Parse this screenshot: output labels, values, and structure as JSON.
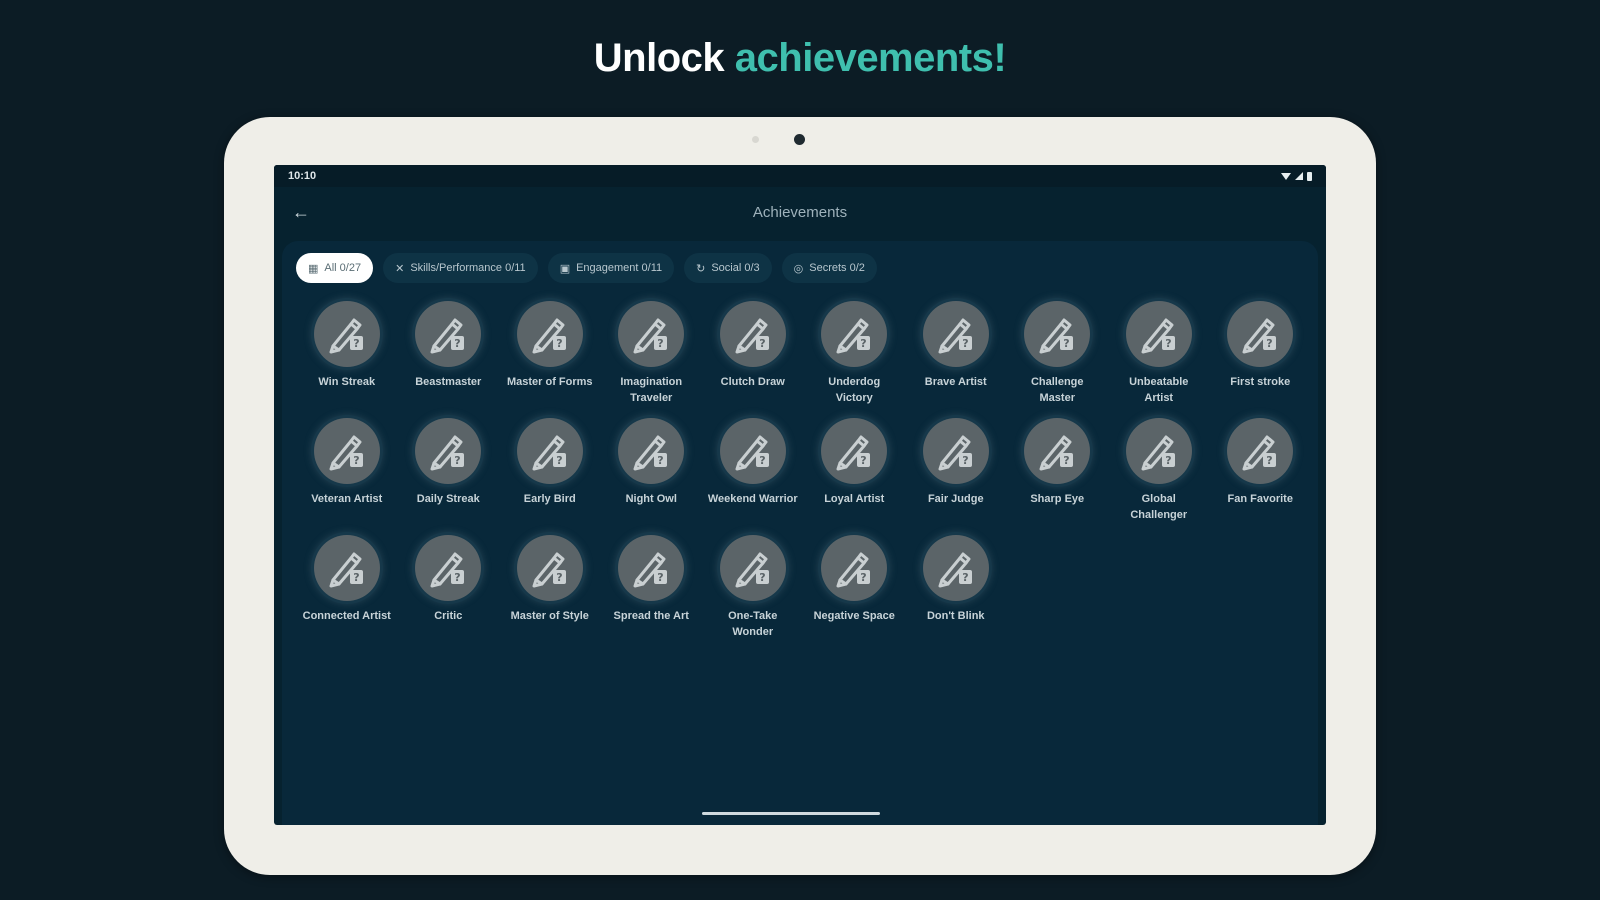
{
  "headline": {
    "part1": "Unlock ",
    "part2": "achievements!"
  },
  "status_bar": {
    "time": "10:10"
  },
  "app_bar": {
    "title": "Achievements"
  },
  "filters": [
    {
      "label": "All 0/27",
      "icon": "grid-icon",
      "selected": true
    },
    {
      "label": "Skills/Performance 0/11",
      "icon": "crossed-swords-icon",
      "selected": false
    },
    {
      "label": "Engagement 0/11",
      "icon": "calendar-icon",
      "selected": false
    },
    {
      "label": "Social 0/3",
      "icon": "share-icon",
      "selected": false
    },
    {
      "label": "Secrets 0/2",
      "icon": "lock-icon",
      "selected": false
    }
  ],
  "achievements": [
    "Win Streak",
    "Beastmaster",
    "Master of Forms",
    "Imagination Traveler",
    "Clutch Draw",
    "Underdog Victory",
    "Brave Artist",
    "Challenge Master",
    "Unbeatable Artist",
    "First stroke",
    "Veteran Artist",
    "Daily Streak",
    "Early Bird",
    "Night Owl",
    "Weekend Warrior",
    "Loyal Artist",
    "Fair Judge",
    "Sharp Eye",
    "Global Challenger",
    "Fan Favorite",
    "Connected Artist",
    "Critic",
    "Master of Style",
    "Spread the Art",
    "One-Take Wonder",
    "Negative Space",
    "Don't Blink"
  ],
  "colors": {
    "accent": "#3fbfae",
    "background": "#0c1c25",
    "screen": "#06222f",
    "badge": "#5b6468"
  }
}
